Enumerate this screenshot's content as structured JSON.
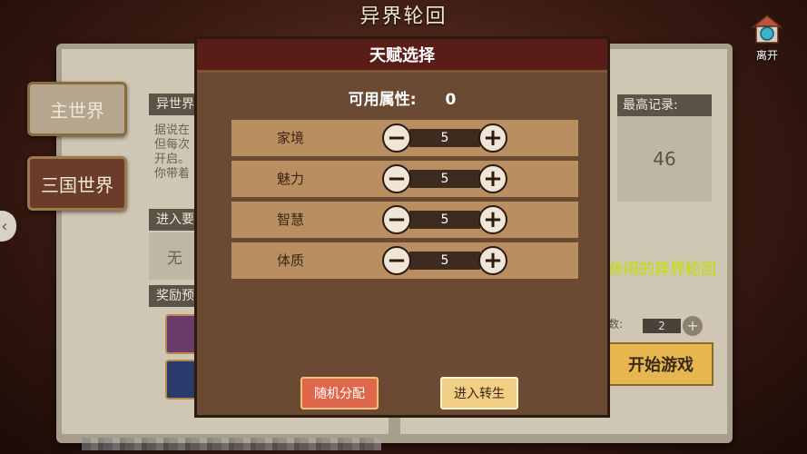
{
  "header": {
    "title": "异界轮回",
    "exit_label": "离开"
  },
  "worlds": {
    "main": "主世界",
    "sanguo": "三国世界"
  },
  "left_page": {
    "section1_title": "异世界",
    "section1_lines": [
      "据说在",
      "但每次",
      "开启。",
      "你带着"
    ],
    "section2_title": "进入要",
    "section2_value": "无",
    "section3_title": "奖励预"
  },
  "right_page": {
    "record_title": "最高记录:",
    "record_value": "46",
    "tagline": "休闲的异界轮回",
    "count_label": "数:",
    "count_value": "2",
    "start_label": "开始游戏"
  },
  "modal": {
    "title": "天赋选择",
    "available_label": "可用属性:",
    "available_value": "0",
    "attributes": [
      {
        "name": "家境",
        "value": "5"
      },
      {
        "name": "魅力",
        "value": "5"
      },
      {
        "name": "智慧",
        "value": "5"
      },
      {
        "name": "体质",
        "value": "5"
      }
    ],
    "random_label": "随机分配",
    "reborn_label": "进入转生"
  },
  "icons": {
    "minus": "−",
    "plus": "+",
    "arrow": "‹"
  },
  "colors": {
    "modal_header": "#5a1c16",
    "row": "#b98f62",
    "accent_green": "#c6d930",
    "start_button": "#e8b64f"
  }
}
